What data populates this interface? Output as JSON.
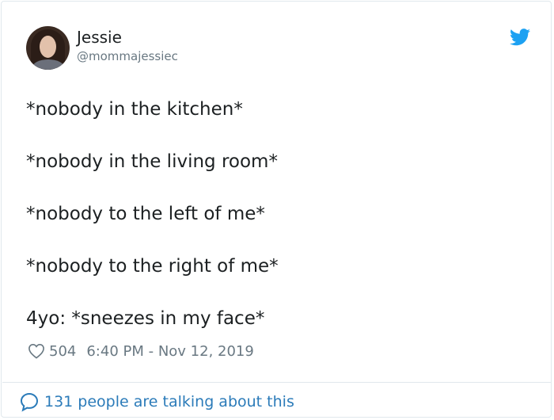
{
  "author": {
    "name": "Jessie",
    "handle": "@mommajessiec"
  },
  "tweet": {
    "lines": [
      "*nobody in the kitchen*",
      "*nobody in the living room*",
      "*nobody to the left of me*",
      "*nobody to the right of me*",
      "4yo: *sneezes in my face*"
    ],
    "likes": "504",
    "timestamp": "6:40 PM - Nov 12, 2019"
  },
  "footer": {
    "conversation_label": "131 people are talking about this"
  },
  "icons": {
    "brand": "twitter-bird-icon",
    "like": "heart-icon",
    "reply": "speech-bubble-icon"
  },
  "colors": {
    "brand": "#1da1f2",
    "link": "#2b7bb9",
    "muted": "#697882",
    "border": "#e1e8ed"
  }
}
